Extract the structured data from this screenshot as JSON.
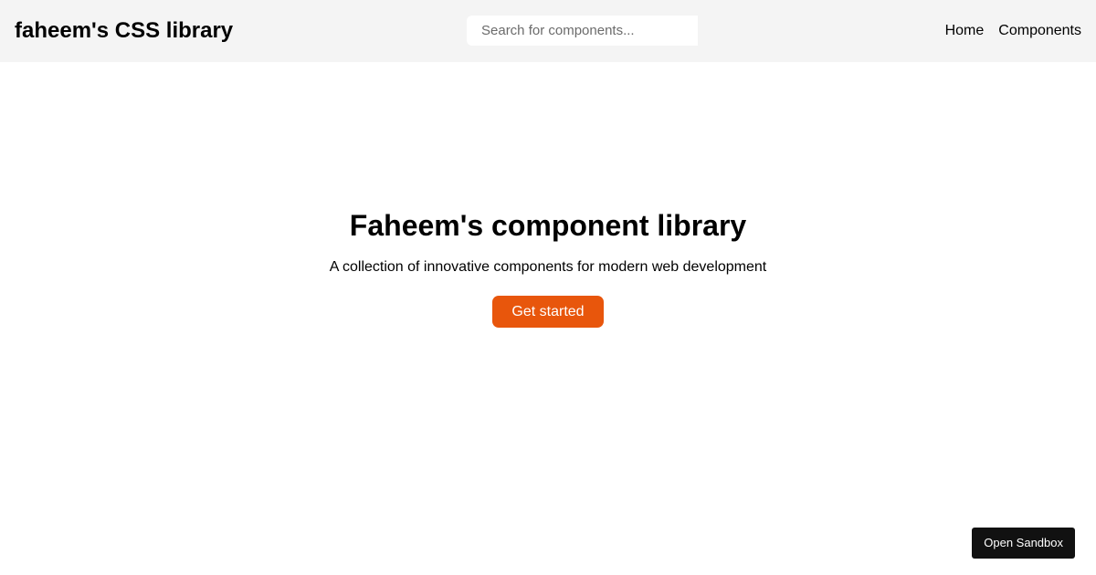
{
  "header": {
    "brand": "faheem's CSS library",
    "search": {
      "placeholder": "Search for components...",
      "value": ""
    },
    "nav": {
      "home": "Home",
      "components": "Components"
    }
  },
  "hero": {
    "title": "Faheem's component library",
    "subtitle": "A collection of innovative components for modern web development",
    "cta_label": "Get started"
  },
  "sandbox_label": "Open Sandbox",
  "colors": {
    "header_bg": "#f4f4f4",
    "accent": "#e8560c",
    "sandbox_bg": "#111111"
  }
}
